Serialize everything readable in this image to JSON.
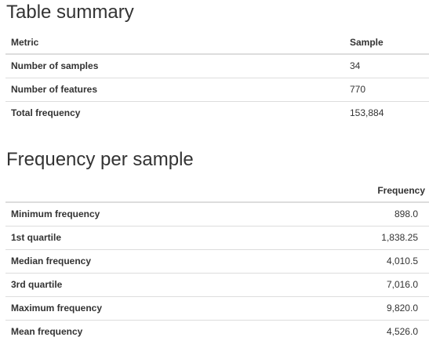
{
  "table_summary": {
    "title": "Table summary",
    "columns": [
      "Metric",
      "Sample"
    ],
    "rows": [
      {
        "metric": "Number of samples",
        "value": "34"
      },
      {
        "metric": "Number of features",
        "value": "770"
      },
      {
        "metric": "Total frequency",
        "value": "153,884"
      }
    ]
  },
  "frequency_per_sample": {
    "title": "Frequency per sample",
    "columns": [
      "",
      "Frequency"
    ],
    "rows": [
      {
        "metric": "Minimum frequency",
        "value": "898.0"
      },
      {
        "metric": "1st quartile",
        "value": "1,838.25"
      },
      {
        "metric": "Median frequency",
        "value": "4,010.5"
      },
      {
        "metric": "3rd quartile",
        "value": "7,016.0"
      },
      {
        "metric": "Maximum frequency",
        "value": "9,820.0"
      },
      {
        "metric": "Mean frequency",
        "value": "4,526.0"
      }
    ]
  }
}
